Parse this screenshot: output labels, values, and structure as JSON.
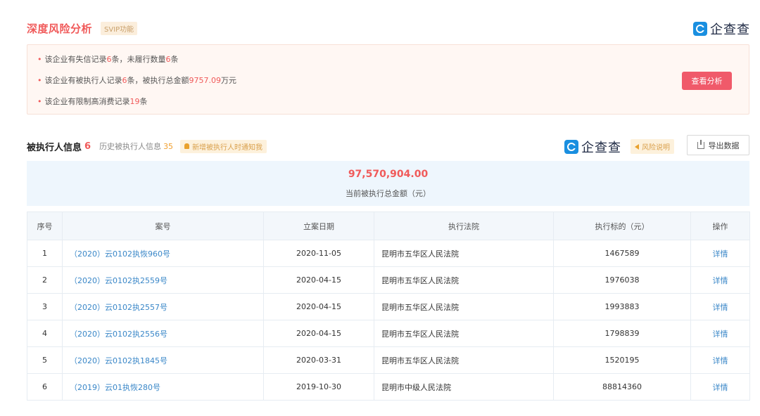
{
  "risk": {
    "title": "深度风险分析",
    "svip": "SVIP功能",
    "items": [
      {
        "prefix": "该企业有失信记录",
        "n1": "6",
        "mid": "条，未履行数量",
        "n2": "6",
        "suffix": "条"
      },
      {
        "prefix": "该企业有被执行人记录",
        "n1": "6",
        "mid": "条，被执行总金额",
        "n2": "9757.09",
        "suffix": "万元"
      },
      {
        "prefix": "该企业有限制高消费记录",
        "n1": "19",
        "mid": "",
        "n2": "",
        "suffix": "条"
      }
    ],
    "button": "查看分析"
  },
  "logo": {
    "text": "企查查"
  },
  "section": {
    "title": "被执行人信息",
    "count": "6",
    "history_label": "历史被执行人信息",
    "history_count": "35",
    "notify": "新增被执行人时通知我",
    "risk_explain": "风险说明",
    "export": "导出数据"
  },
  "summary": {
    "amount": "97,570,904.00",
    "label": "当前被执行总金额（元）"
  },
  "table": {
    "headers": [
      "序号",
      "案号",
      "立案日期",
      "执行法院",
      "执行标的（元）",
      "操作"
    ],
    "rows": [
      {
        "no": "1",
        "case": "（2020）云0102执恢960号",
        "date": "2020-11-05",
        "court": "昆明市五华区人民法院",
        "amount": "1467589",
        "op": "详情"
      },
      {
        "no": "2",
        "case": "（2020）云0102执2559号",
        "date": "2020-04-15",
        "court": "昆明市五华区人民法院",
        "amount": "1976038",
        "op": "详情"
      },
      {
        "no": "3",
        "case": "（2020）云0102执2557号",
        "date": "2020-04-15",
        "court": "昆明市五华区人民法院",
        "amount": "1993883",
        "op": "详情"
      },
      {
        "no": "4",
        "case": "（2020）云0102执2556号",
        "date": "2020-04-15",
        "court": "昆明市五华区人民法院",
        "amount": "1798839",
        "op": "详情"
      },
      {
        "no": "5",
        "case": "（2020）云0102执1845号",
        "date": "2020-03-31",
        "court": "昆明市五华区人民法院",
        "amount": "1520195",
        "op": "详情"
      },
      {
        "no": "6",
        "case": "（2019）云01执恢280号",
        "date": "2019-10-30",
        "court": "昆明市中级人民法院",
        "amount": "88814360",
        "op": "详情"
      }
    ]
  }
}
